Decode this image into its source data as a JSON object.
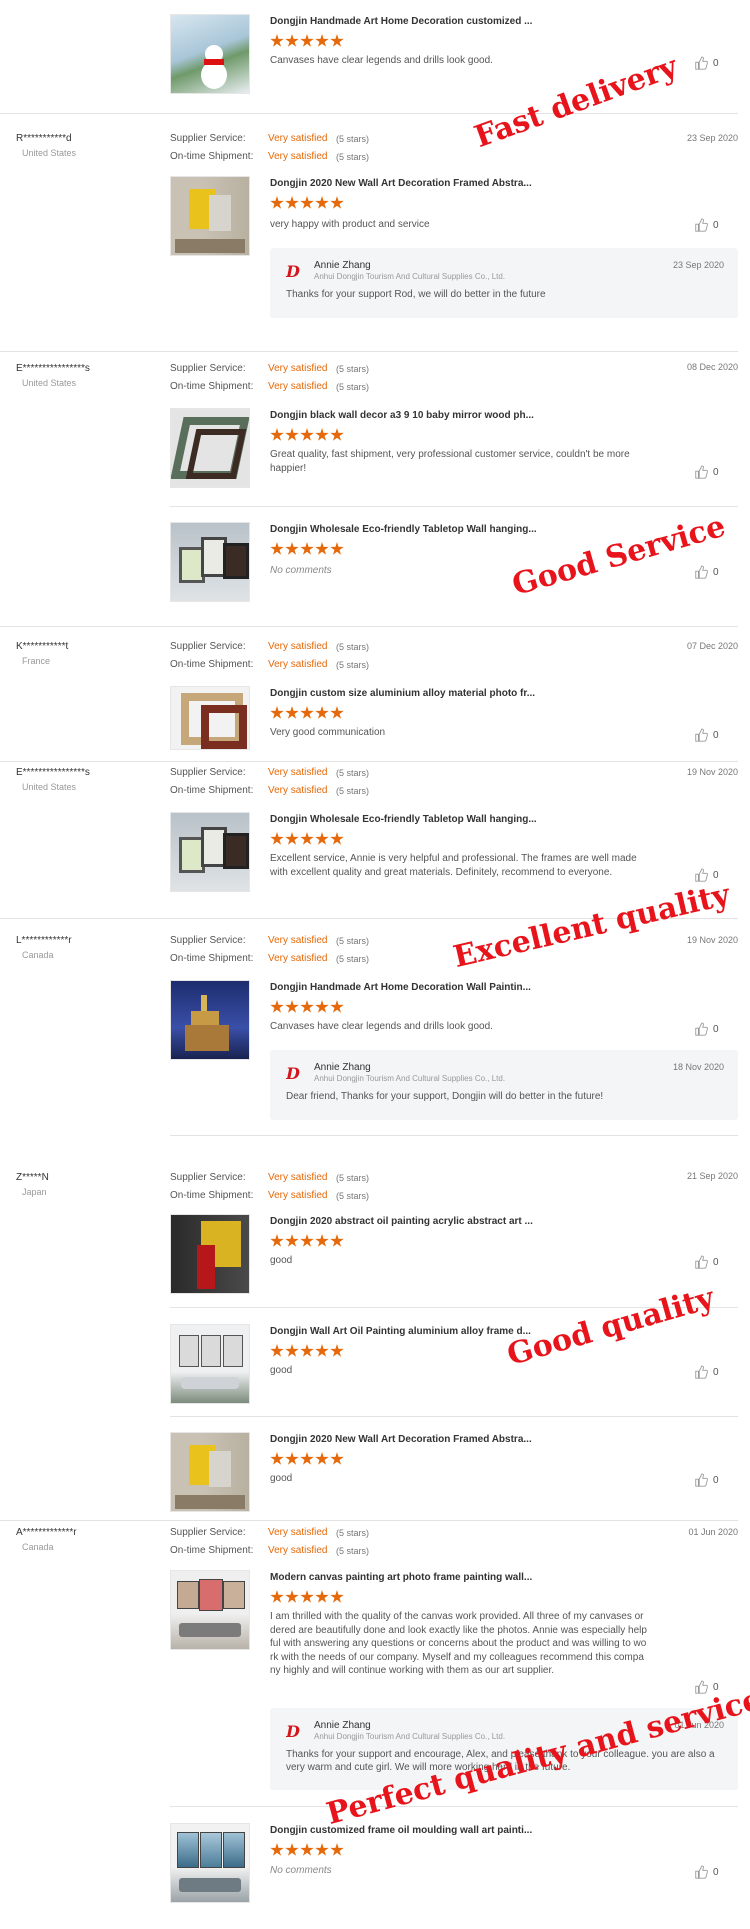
{
  "overlays": [
    "Fast delivery",
    "Good Service",
    "Excellent quality",
    "Good quality",
    "Perfect quality and service"
  ],
  "labels": {
    "supplier": "Supplier Service:",
    "shipment": "On-time Shipment:",
    "satisfied": "Very satisfied",
    "stars": "(5 stars)"
  },
  "top_item": {
    "title": "Dongjin Handmade Art Home Decoration customized ...",
    "comment": "Canvases have clear legends and drills look good.",
    "likes": "0"
  },
  "reviews": [
    {
      "user": "R***********d",
      "country": "United States",
      "date": "23 Sep 2020",
      "items": [
        {
          "title": "Dongjin 2020 New Wall Art Decoration Framed Abstra...",
          "comment": "very happy with product and service",
          "likes": "0"
        }
      ],
      "reply": {
        "name": "Annie Zhang",
        "company": "Anhui Dongjin Tourism And Cultural Supplies Co., Ltd.",
        "date": "23 Sep 2020",
        "text": "Thanks for your support Rod, we will do better in the future"
      }
    },
    {
      "user": "E****************s",
      "country": "United States",
      "date": "08 Dec 2020",
      "items": [
        {
          "title": "Dongjin black wall decor a3 9 10 baby mirror wood ph...",
          "comment": "Great quality, fast shipment, very professional customer service, couldn't be more happier!",
          "likes": "0"
        },
        {
          "title": "Dongjin Wholesale Eco-friendly Tabletop Wall hanging...",
          "comment": "No comments",
          "likes": "0"
        }
      ]
    },
    {
      "user": "K***********t",
      "country": "France",
      "date": "07 Dec 2020",
      "items": [
        {
          "title": "Dongjin custom size aluminium alloy material photo fr...",
          "comment": "Very good communication",
          "likes": "0"
        }
      ]
    },
    {
      "user": "E****************s",
      "country": "United States",
      "date": "19 Nov 2020",
      "items": [
        {
          "title": "Dongjin Wholesale Eco-friendly Tabletop Wall hanging...",
          "comment": "Excellent service, Annie is very helpful and professional. The frames are well made with excellent quality and great materials. Definitely, recommend to everyone.",
          "likes": "0"
        }
      ]
    },
    {
      "user": "L************r",
      "country": "Canada",
      "date": "19 Nov 2020",
      "items": [
        {
          "title": "Dongjin Handmade Art Home Decoration Wall Paintin...",
          "comment": "Canvases have clear legends and drills look good.",
          "likes": "0"
        }
      ],
      "reply": {
        "name": "Annie Zhang",
        "company": "Anhui Dongjin Tourism And Cultural Supplies Co., Ltd.",
        "date": "18 Nov 2020",
        "text": "Dear friend, Thanks for your support, Dongjin will do better in the future!"
      }
    },
    {
      "user": "Z*****N",
      "country": "Japan",
      "date": "21 Sep 2020",
      "items": [
        {
          "title": "Dongjin 2020 abstract oil painting acrylic abstract art ...",
          "comment": "good",
          "likes": "0"
        },
        {
          "title": "Dongjin Wall Art Oil Painting aluminium alloy frame d...",
          "comment": "good",
          "likes": "0"
        },
        {
          "title": "Dongjin 2020 New Wall Art Decoration Framed Abstra...",
          "comment": "good",
          "likes": "0"
        }
      ]
    },
    {
      "user": "A*************r",
      "country": "Canada",
      "date": "01 Jun 2020",
      "items": [
        {
          "title": "Modern canvas painting art photo frame painting wall...",
          "comment": "I am thrilled with the quality of the canvas work provided. All three of my canvases ordered are beautifully done and look exactly like the photos. Annie was especially helpful with answering any questions or concerns about the product and was willing to work with the needs of our company. Myself and my colleagues recommend this company highly and will continue working with them as our art supplier.",
          "likes": "0"
        },
        {
          "title": "Dongjin customized frame oil moulding wall art painti...",
          "comment": "No comments",
          "likes": "0"
        }
      ],
      "reply": {
        "name": "Annie Zhang",
        "company": "Anhui Dongjin Tourism And Cultural Supplies Co., Ltd.",
        "date": "01 Jun 2020",
        "text": "Thanks for your support and encourage, Alex, and please thank to your colleague.  you are also a very warm and cute girl.  We will more working hard in the future."
      }
    }
  ]
}
